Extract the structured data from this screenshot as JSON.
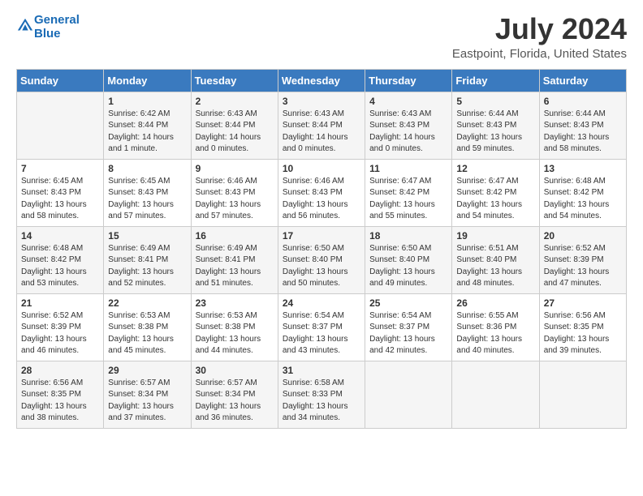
{
  "logo": {
    "line1": "General",
    "line2": "Blue"
  },
  "title": "July 2024",
  "subtitle": "Eastpoint, Florida, United States",
  "days_header": [
    "Sunday",
    "Monday",
    "Tuesday",
    "Wednesday",
    "Thursday",
    "Friday",
    "Saturday"
  ],
  "weeks": [
    [
      {
        "day": "",
        "info": ""
      },
      {
        "day": "1",
        "info": "Sunrise: 6:42 AM\nSunset: 8:44 PM\nDaylight: 14 hours\nand 1 minute."
      },
      {
        "day": "2",
        "info": "Sunrise: 6:43 AM\nSunset: 8:44 PM\nDaylight: 14 hours\nand 0 minutes."
      },
      {
        "day": "3",
        "info": "Sunrise: 6:43 AM\nSunset: 8:44 PM\nDaylight: 14 hours\nand 0 minutes."
      },
      {
        "day": "4",
        "info": "Sunrise: 6:43 AM\nSunset: 8:43 PM\nDaylight: 14 hours\nand 0 minutes."
      },
      {
        "day": "5",
        "info": "Sunrise: 6:44 AM\nSunset: 8:43 PM\nDaylight: 13 hours\nand 59 minutes."
      },
      {
        "day": "6",
        "info": "Sunrise: 6:44 AM\nSunset: 8:43 PM\nDaylight: 13 hours\nand 58 minutes."
      }
    ],
    [
      {
        "day": "7",
        "info": "Sunrise: 6:45 AM\nSunset: 8:43 PM\nDaylight: 13 hours\nand 58 minutes."
      },
      {
        "day": "8",
        "info": "Sunrise: 6:45 AM\nSunset: 8:43 PM\nDaylight: 13 hours\nand 57 minutes."
      },
      {
        "day": "9",
        "info": "Sunrise: 6:46 AM\nSunset: 8:43 PM\nDaylight: 13 hours\nand 57 minutes."
      },
      {
        "day": "10",
        "info": "Sunrise: 6:46 AM\nSunset: 8:43 PM\nDaylight: 13 hours\nand 56 minutes."
      },
      {
        "day": "11",
        "info": "Sunrise: 6:47 AM\nSunset: 8:42 PM\nDaylight: 13 hours\nand 55 minutes."
      },
      {
        "day": "12",
        "info": "Sunrise: 6:47 AM\nSunset: 8:42 PM\nDaylight: 13 hours\nand 54 minutes."
      },
      {
        "day": "13",
        "info": "Sunrise: 6:48 AM\nSunset: 8:42 PM\nDaylight: 13 hours\nand 54 minutes."
      }
    ],
    [
      {
        "day": "14",
        "info": "Sunrise: 6:48 AM\nSunset: 8:42 PM\nDaylight: 13 hours\nand 53 minutes."
      },
      {
        "day": "15",
        "info": "Sunrise: 6:49 AM\nSunset: 8:41 PM\nDaylight: 13 hours\nand 52 minutes."
      },
      {
        "day": "16",
        "info": "Sunrise: 6:49 AM\nSunset: 8:41 PM\nDaylight: 13 hours\nand 51 minutes."
      },
      {
        "day": "17",
        "info": "Sunrise: 6:50 AM\nSunset: 8:40 PM\nDaylight: 13 hours\nand 50 minutes."
      },
      {
        "day": "18",
        "info": "Sunrise: 6:50 AM\nSunset: 8:40 PM\nDaylight: 13 hours\nand 49 minutes."
      },
      {
        "day": "19",
        "info": "Sunrise: 6:51 AM\nSunset: 8:40 PM\nDaylight: 13 hours\nand 48 minutes."
      },
      {
        "day": "20",
        "info": "Sunrise: 6:52 AM\nSunset: 8:39 PM\nDaylight: 13 hours\nand 47 minutes."
      }
    ],
    [
      {
        "day": "21",
        "info": "Sunrise: 6:52 AM\nSunset: 8:39 PM\nDaylight: 13 hours\nand 46 minutes."
      },
      {
        "day": "22",
        "info": "Sunrise: 6:53 AM\nSunset: 8:38 PM\nDaylight: 13 hours\nand 45 minutes."
      },
      {
        "day": "23",
        "info": "Sunrise: 6:53 AM\nSunset: 8:38 PM\nDaylight: 13 hours\nand 44 minutes."
      },
      {
        "day": "24",
        "info": "Sunrise: 6:54 AM\nSunset: 8:37 PM\nDaylight: 13 hours\nand 43 minutes."
      },
      {
        "day": "25",
        "info": "Sunrise: 6:54 AM\nSunset: 8:37 PM\nDaylight: 13 hours\nand 42 minutes."
      },
      {
        "day": "26",
        "info": "Sunrise: 6:55 AM\nSunset: 8:36 PM\nDaylight: 13 hours\nand 40 minutes."
      },
      {
        "day": "27",
        "info": "Sunrise: 6:56 AM\nSunset: 8:35 PM\nDaylight: 13 hours\nand 39 minutes."
      }
    ],
    [
      {
        "day": "28",
        "info": "Sunrise: 6:56 AM\nSunset: 8:35 PM\nDaylight: 13 hours\nand 38 minutes."
      },
      {
        "day": "29",
        "info": "Sunrise: 6:57 AM\nSunset: 8:34 PM\nDaylight: 13 hours\nand 37 minutes."
      },
      {
        "day": "30",
        "info": "Sunrise: 6:57 AM\nSunset: 8:34 PM\nDaylight: 13 hours\nand 36 minutes."
      },
      {
        "day": "31",
        "info": "Sunrise: 6:58 AM\nSunset: 8:33 PM\nDaylight: 13 hours\nand 34 minutes."
      },
      {
        "day": "",
        "info": ""
      },
      {
        "day": "",
        "info": ""
      },
      {
        "day": "",
        "info": ""
      }
    ]
  ]
}
